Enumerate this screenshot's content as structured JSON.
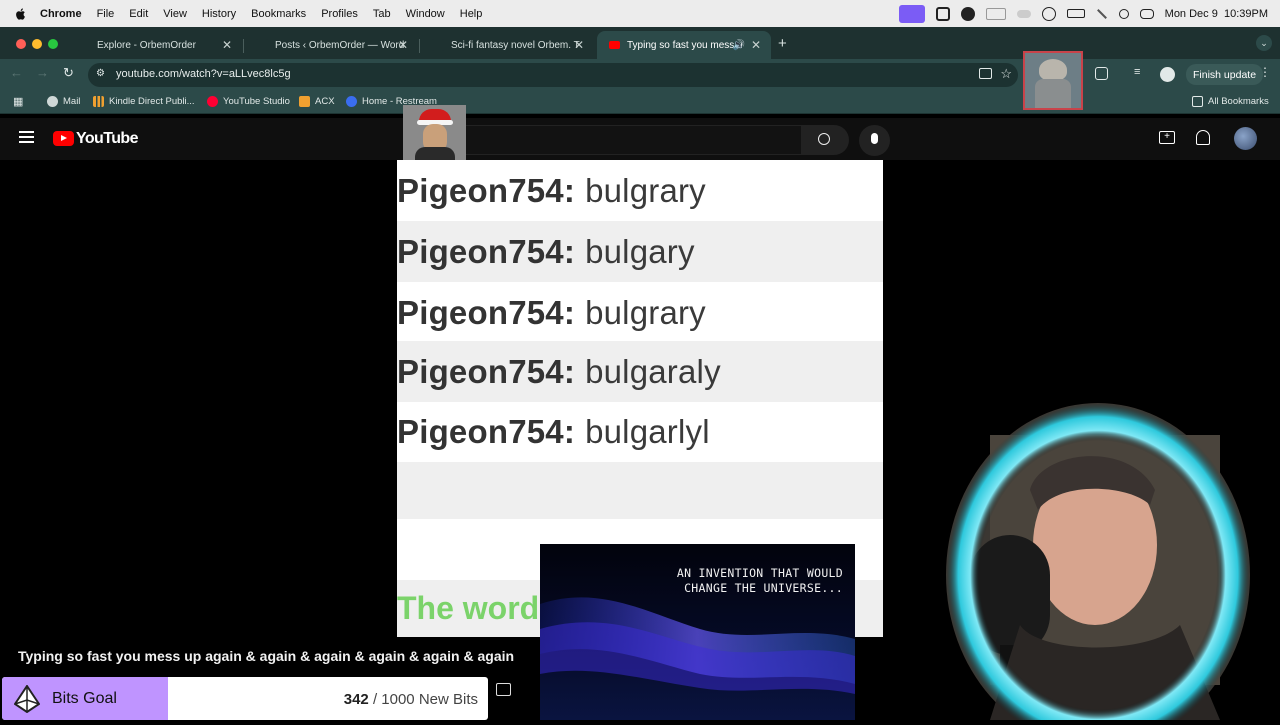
{
  "menubar": {
    "app": "Chrome",
    "items": [
      "File",
      "Edit",
      "View",
      "History",
      "Bookmarks",
      "Profiles",
      "Tab",
      "Window",
      "Help"
    ],
    "clock": "Mon Dec 9  10:39PM"
  },
  "tabs": [
    {
      "title": "Explore - OrbemOrder",
      "active": false
    },
    {
      "title": "Posts ‹ OrbemOrder — Word",
      "active": false
    },
    {
      "title": "Sci-fi fantasy novel Orbem. T",
      "active": false
    },
    {
      "title": "Typing so fast you mess u",
      "active": true
    }
  ],
  "toolbar": {
    "url": "youtube.com/watch?v=aLLvec8lc5g",
    "finish_update": "Finish update"
  },
  "bookmarks": {
    "items": [
      "Mail",
      "Kindle Direct Publi...",
      "YouTube Studio",
      "ACX",
      "Home - Restream"
    ],
    "all": "All Bookmarks"
  },
  "youtube": {
    "logo": "YouTube",
    "video_title": "Typing so fast you mess up again & again & again & again & again & again"
  },
  "chat": {
    "rows": [
      {
        "user": "Pigeon754:",
        "msg": "bulgrary"
      },
      {
        "user": "Pigeon754:",
        "msg": "bulgary"
      },
      {
        "user": "Pigeon754:",
        "msg": "bulgrary"
      },
      {
        "user": "Pigeon754:",
        "msg": "bulgaraly"
      },
      {
        "user": "Pigeon754:",
        "msg": "bulgarlyl"
      }
    ],
    "footer_text": "The word"
  },
  "overlay": {
    "invention_text": "AN INVENTION THAT WOULD\nCHANGE THE UNIVERSE..."
  },
  "bits_goal": {
    "label": "Bits Goal",
    "current": "342",
    "total": " / 1000 New Bits",
    "progress": 0.342
  },
  "colors": {
    "tab_bg": "#1e3130",
    "toolbar_bg": "#2c4a49",
    "bits_fill": "#bf94ff",
    "yt_red": "#ff0000"
  }
}
